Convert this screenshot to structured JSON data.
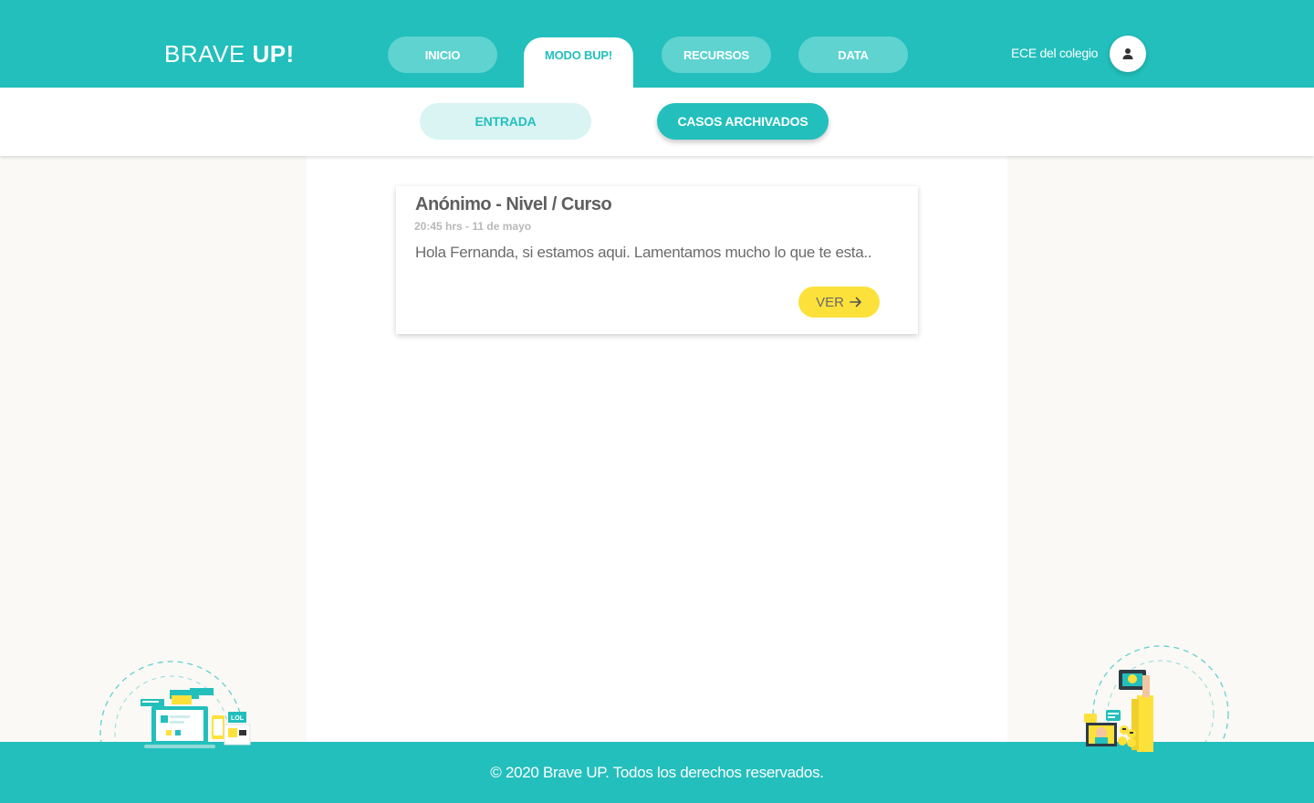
{
  "header": {
    "logo_light": "BRAVE ",
    "logo_bold": "UP!",
    "tabs": [
      {
        "label": "INICIO"
      },
      {
        "label": "MODO BUP!"
      },
      {
        "label": "RECURSOS"
      },
      {
        "label": "DATA"
      }
    ],
    "active_tab": "MODO BUP!",
    "user_name": "ECE del colegio",
    "avatar_icon": "user-icon"
  },
  "subnav": {
    "tabs": [
      {
        "label": "ENTRADA"
      },
      {
        "label": "CASOS ARCHIVADOS"
      }
    ],
    "active_tab": "CASOS ARCHIVADOS"
  },
  "cases": [
    {
      "title": "Anónimo - Nivel / Curso",
      "time": "20:45 hrs - 11 de mayo",
      "message": "Hola Fernanda, si estamos aqui. Lamentamos mucho lo que te esta..",
      "button_label": "VER",
      "button_icon": "arrow-right-icon"
    }
  ],
  "footer": {
    "text": "© 2020 Brave UP. Todos los derechos reservados."
  },
  "colors": {
    "primary": "#22bfbc",
    "tab_inactive": "#5fd3d0",
    "subtab_inactive": "#d9f4f3",
    "button_yellow": "#fde13b",
    "background": "#faf9f6"
  },
  "illustration_labels": {
    "lol_sign": "LOL"
  }
}
